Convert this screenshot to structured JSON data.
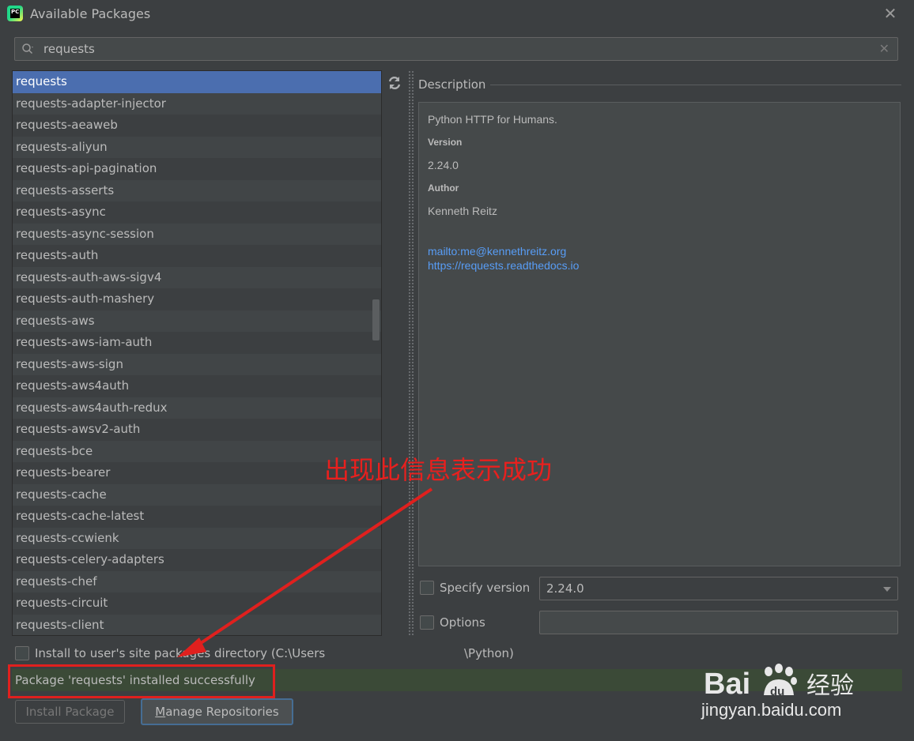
{
  "window": {
    "title": "Available Packages",
    "app_icon_text": "PC",
    "close_glyph": "✕"
  },
  "search": {
    "value": "requests",
    "icon": "search-icon",
    "clear_glyph": "✕"
  },
  "packages": [
    "requests",
    "requests-adapter-injector",
    "requests-aeaweb",
    "requests-aliyun",
    "requests-api-pagination",
    "requests-asserts",
    "requests-async",
    "requests-async-session",
    "requests-auth",
    "requests-auth-aws-sigv4",
    "requests-auth-mashery",
    "requests-aws",
    "requests-aws-iam-auth",
    "requests-aws-sign",
    "requests-aws4auth",
    "requests-aws4auth-redux",
    "requests-awsv2-auth",
    "requests-bce",
    "requests-bearer",
    "requests-cache",
    "requests-cache-latest",
    "requests-ccwienk",
    "requests-celery-adapters",
    "requests-chef",
    "requests-circuit",
    "requests-client"
  ],
  "selected_package": "requests",
  "description": {
    "label": "Description",
    "summary": "Python HTTP for Humans.",
    "version_header": "Version",
    "version": "2.24.0",
    "author_header": "Author",
    "author": "Kenneth Reitz",
    "links": [
      "mailto:me@kennethreitz.org",
      "https://requests.readthedocs.io"
    ]
  },
  "specify_version": {
    "label": "Specify version",
    "checked": false,
    "value": "2.24.0"
  },
  "options": {
    "label": "Options",
    "checked": false,
    "value": ""
  },
  "install_to_user": {
    "label": "Install to user's site packages directory (C:\\Users",
    "label_end": "\\Python)",
    "checked": false
  },
  "status": {
    "message": "Package 'requests' installed successfully"
  },
  "buttons": {
    "install": "Install Package",
    "manage_prefix": "M",
    "manage_rest": "anage Repositories"
  },
  "annotation": {
    "text": "出现此信息表示成功",
    "color": "#e8201e"
  },
  "watermark": {
    "brand": "Bai",
    "du": "du",
    "cn": "经验",
    "url": "jingyan.baidu.com"
  },
  "colors": {
    "background": "#3c3f41",
    "selection": "#4b6eaf",
    "link": "#589df6",
    "status_bg": "#3b4a37",
    "highlight_box": "#e0201e"
  }
}
